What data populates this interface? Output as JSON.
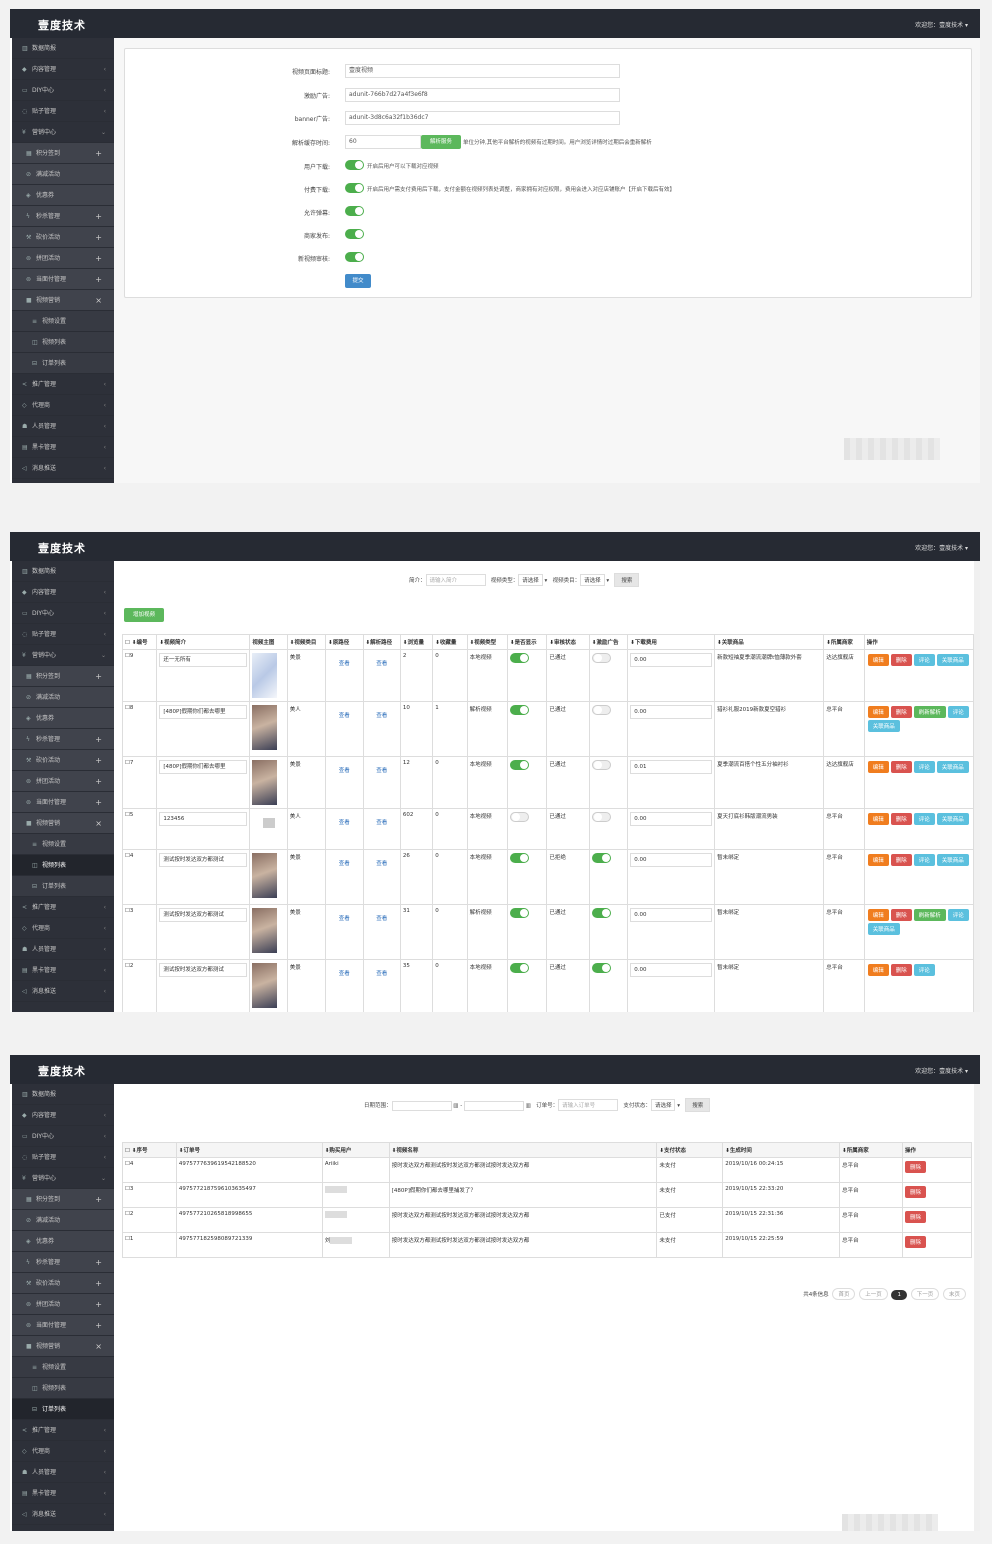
{
  "app": {
    "brand": "壹度技术",
    "welcome": "欢迎您：壹度技术 ▾"
  },
  "menu": {
    "top": [
      {
        "icon": "▥",
        "label": "数据简报"
      },
      {
        "icon": "◆",
        "label": "内容管理"
      },
      {
        "icon": "▭",
        "label": "DIY中心"
      },
      {
        "icon": "◌",
        "label": "贴子管理"
      },
      {
        "icon": "¥",
        "label": "营销中心"
      }
    ],
    "marketing": [
      {
        "icon": "▦",
        "label": "积分签到"
      },
      {
        "icon": "⊘",
        "label": "满减活动"
      },
      {
        "icon": "◈",
        "label": "优惠券"
      },
      {
        "icon": "ϟ",
        "label": "秒杀管理"
      },
      {
        "icon": "⚒",
        "label": "砍价活动"
      },
      {
        "icon": "⊚",
        "label": "拼团活动"
      },
      {
        "icon": "⊚",
        "label": "当面付管理"
      },
      {
        "icon": "■",
        "label": "视频营销"
      }
    ],
    "video": [
      {
        "icon": "≡",
        "label": "视频设置"
      },
      {
        "icon": "◫",
        "label": "视频列表"
      },
      {
        "icon": "⊟",
        "label": "订单列表"
      }
    ],
    "bottom": [
      {
        "icon": "<",
        "label": "推广管理"
      },
      {
        "icon": "◇",
        "label": "代理商"
      },
      {
        "icon": "☗",
        "label": "人员管理"
      },
      {
        "icon": "▤",
        "label": "黑卡管理"
      },
      {
        "icon": "◁",
        "label": "消息推送"
      }
    ]
  },
  "settings": {
    "labels": [
      "视频页面标题:",
      "激励广告:",
      "banner广告:",
      "解析缓存时间:",
      "用户下载:",
      "付费下载:",
      "允许弹幕:",
      "商家发布:",
      "新视频审核:"
    ],
    "title_value": "壹度视频",
    "reward_ad": "adunit-766b7d27a4f3e6f8",
    "banner_ad": "adunit-3d8c6a32f1b36dc7",
    "cache_time": "60",
    "parse_btn": "解析服务",
    "cache_hint": "单位分钟,其他平台解析的视频有过期时间。用户浏览详情时过期后会重新解析",
    "user_dl_hint": "开启后用户可以下载对应视频",
    "paid_dl_hint": "开启后用户需支付费用后下载，支付金额在视频列表处调整，商家拥有对应权限，费用会进入对应店铺账户【开启下载后有效】",
    "submit": "提交"
  },
  "video_list": {
    "filter": {
      "intro_label": "简介：",
      "intro_placeholder": "请输入简介",
      "type_label": "视频类型：",
      "type_value": "请选择",
      "cat_label": "视频类目：",
      "cat_value": "请选择",
      "search": "搜索"
    },
    "add_btn": "增加视频",
    "headers": [
      "☐ ⬇编号",
      "⬇视频简介",
      "视频主图",
      "⬇视频类目",
      "⬇原路径",
      "⬇解析路径",
      "⬇浏览量",
      "⬇收藏量",
      "⬇视频类型",
      "⬇是否显示",
      "⬇审核状态",
      "⬇激励广告",
      "⬇下载费用",
      "⬇关联商品",
      "⬇所属商家",
      "操作"
    ],
    "rows": [
      {
        "id": "☐9",
        "intro": "还一无所有",
        "thumb": "map",
        "cat": "美景",
        "src": "查看",
        "parse": "查看",
        "views": "2",
        "fav": "0",
        "type": "本地视频",
        "show": true,
        "audit": "已通过",
        "ad": false,
        "fee": "0.00",
        "goods": "新款短袖夏季潮流潮牌t恤薄款外套",
        "shop": "达达旗舰店",
        "ops": [
          [
            "编辑",
            "org"
          ],
          [
            "删除",
            "red"
          ],
          [
            "评论",
            "blue"
          ],
          [
            "关联商品",
            "blue"
          ]
        ]
      },
      {
        "id": "☐8",
        "intro": "[480P]假期你们都去哪里",
        "thumb": "photo",
        "cat": "美人",
        "src": "查看",
        "parse": "查看",
        "views": "10",
        "fav": "1",
        "type": "解析视频",
        "show": true,
        "audit": "已通过",
        "ad": false,
        "fee": "0.00",
        "goods": "猎衫礼服2019新款夏空猎衫",
        "shop": "总平台",
        "ops": [
          [
            "编辑",
            "org"
          ],
          [
            "删除",
            "red"
          ],
          [
            "刷新解析",
            "green"
          ],
          [
            "评论",
            "blue"
          ],
          [
            "关联商品",
            "blue"
          ]
        ]
      },
      {
        "id": "☐7",
        "intro": "[480P]假期你们都去哪里",
        "thumb": "photo",
        "cat": "美景",
        "src": "查看",
        "parse": "查看",
        "views": "12",
        "fav": "0",
        "type": "本地视频",
        "show": true,
        "audit": "已通过",
        "ad": false,
        "fee": "0.01",
        "goods": "夏季潮流百搭个性五分袖衬衫",
        "shop": "达达旗舰店",
        "ops": [
          [
            "编辑",
            "org"
          ],
          [
            "删除",
            "red"
          ],
          [
            "评论",
            "blue"
          ],
          [
            "关联商品",
            "blue"
          ]
        ]
      },
      {
        "id": "☐5",
        "intro": "123456",
        "thumb": "small",
        "cat": "美人",
        "src": "查看",
        "parse": "查看",
        "views": "602",
        "fav": "0",
        "type": "本地视频",
        "show": false,
        "audit": "已通过",
        "ad": false,
        "fee": "0.00",
        "goods": "夏天打底衫韩版潮流男装",
        "shop": "总平台",
        "ops": [
          [
            "编辑",
            "org"
          ],
          [
            "删除",
            "red"
          ],
          [
            "评论",
            "blue"
          ],
          [
            "关联商品",
            "blue"
          ]
        ]
      },
      {
        "id": "☐4",
        "intro": "测试按时发达双方都测试",
        "thumb": "photo",
        "cat": "美景",
        "src": "查看",
        "parse": "查看",
        "views": "26",
        "fav": "0",
        "type": "本地视频",
        "show": true,
        "audit": "已拒绝",
        "ad": true,
        "fee": "0.00",
        "goods": "暂未绑定",
        "shop": "总平台",
        "ops": [
          [
            "编辑",
            "org"
          ],
          [
            "删除",
            "red"
          ],
          [
            "评论",
            "blue"
          ],
          [
            "关联商品",
            "blue"
          ]
        ]
      },
      {
        "id": "☐3",
        "intro": "测试按时发达双方都测试",
        "thumb": "photo",
        "cat": "美景",
        "src": "查看",
        "parse": "查看",
        "views": "31",
        "fav": "0",
        "type": "解析视频",
        "show": true,
        "audit": "已通过",
        "ad": true,
        "fee": "0.00",
        "goods": "暂未绑定",
        "shop": "总平台",
        "ops": [
          [
            "编辑",
            "org"
          ],
          [
            "删除",
            "red"
          ],
          [
            "刷新解析",
            "green"
          ],
          [
            "评论",
            "blue"
          ],
          [
            "关联商品",
            "blue"
          ]
        ]
      },
      {
        "id": "☐2",
        "intro": "测试按时发达双方都测试",
        "thumb": "photo",
        "cat": "美景",
        "src": "查看",
        "parse": "查看",
        "views": "35",
        "fav": "0",
        "type": "本地视频",
        "show": true,
        "audit": "已通过",
        "ad": true,
        "fee": "0.00",
        "goods": "暂未绑定",
        "shop": "总平台",
        "ops": [
          [
            "编辑",
            "org"
          ],
          [
            "删除",
            "red"
          ],
          [
            "评论",
            "blue"
          ]
        ]
      }
    ]
  },
  "orders": {
    "filter": {
      "date_label": "日期范围：",
      "order_label": "订单号：",
      "order_placeholder": "请输入订单号",
      "pay_label": "支付状态：",
      "pay_value": "请选择",
      "search": "搜索"
    },
    "headers": [
      "☐ ⬇序号",
      "⬇订单号",
      "⬇购买用户",
      "⬇视频名称",
      "⬇支付状态",
      "⬇生成时间",
      "⬇所属商家",
      "操作"
    ],
    "rows": [
      {
        "id": "☐4",
        "no": "497577763961954218852​0",
        "user": "Ariiki",
        "video": "按时发达双方都测试按时发达双方都测试按时发达双方都",
        "status": "未支付",
        "time": "2019/10/16 00:24:15",
        "shop": "总平台",
        "op": "删除"
      },
      {
        "id": "☐3",
        "no": "49757721875961036354​97",
        "user": "",
        "video": "[480P]假期你们都去哪里捕发了？",
        "status": "未支付",
        "time": "2019/10/15 22:33:20",
        "shop": "总平台",
        "op": "删除"
      },
      {
        "id": "☐2",
        "no": "49757721026581899865​5",
        "user": "",
        "video": "按时发达双方都测试按时发达双方都测试按时发达双方都",
        "status": "已支付",
        "time": "2019/10/15 22:31:36",
        "shop": "总平台",
        "op": "删除"
      },
      {
        "id": "☐1",
        "no": "49757718259808972133​9",
        "user": "刘",
        "video": "按时发达双方都测试按时发达双方都测试按时发达双方都",
        "status": "未支付",
        "time": "2019/10/15 22:25:59",
        "shop": "总平台",
        "op": "删除"
      }
    ],
    "pager": {
      "total": "共4条信息",
      "first": "首页",
      "prev": "上一页",
      "cur": "1",
      "next": "下一页",
      "last": "末页"
    }
  }
}
